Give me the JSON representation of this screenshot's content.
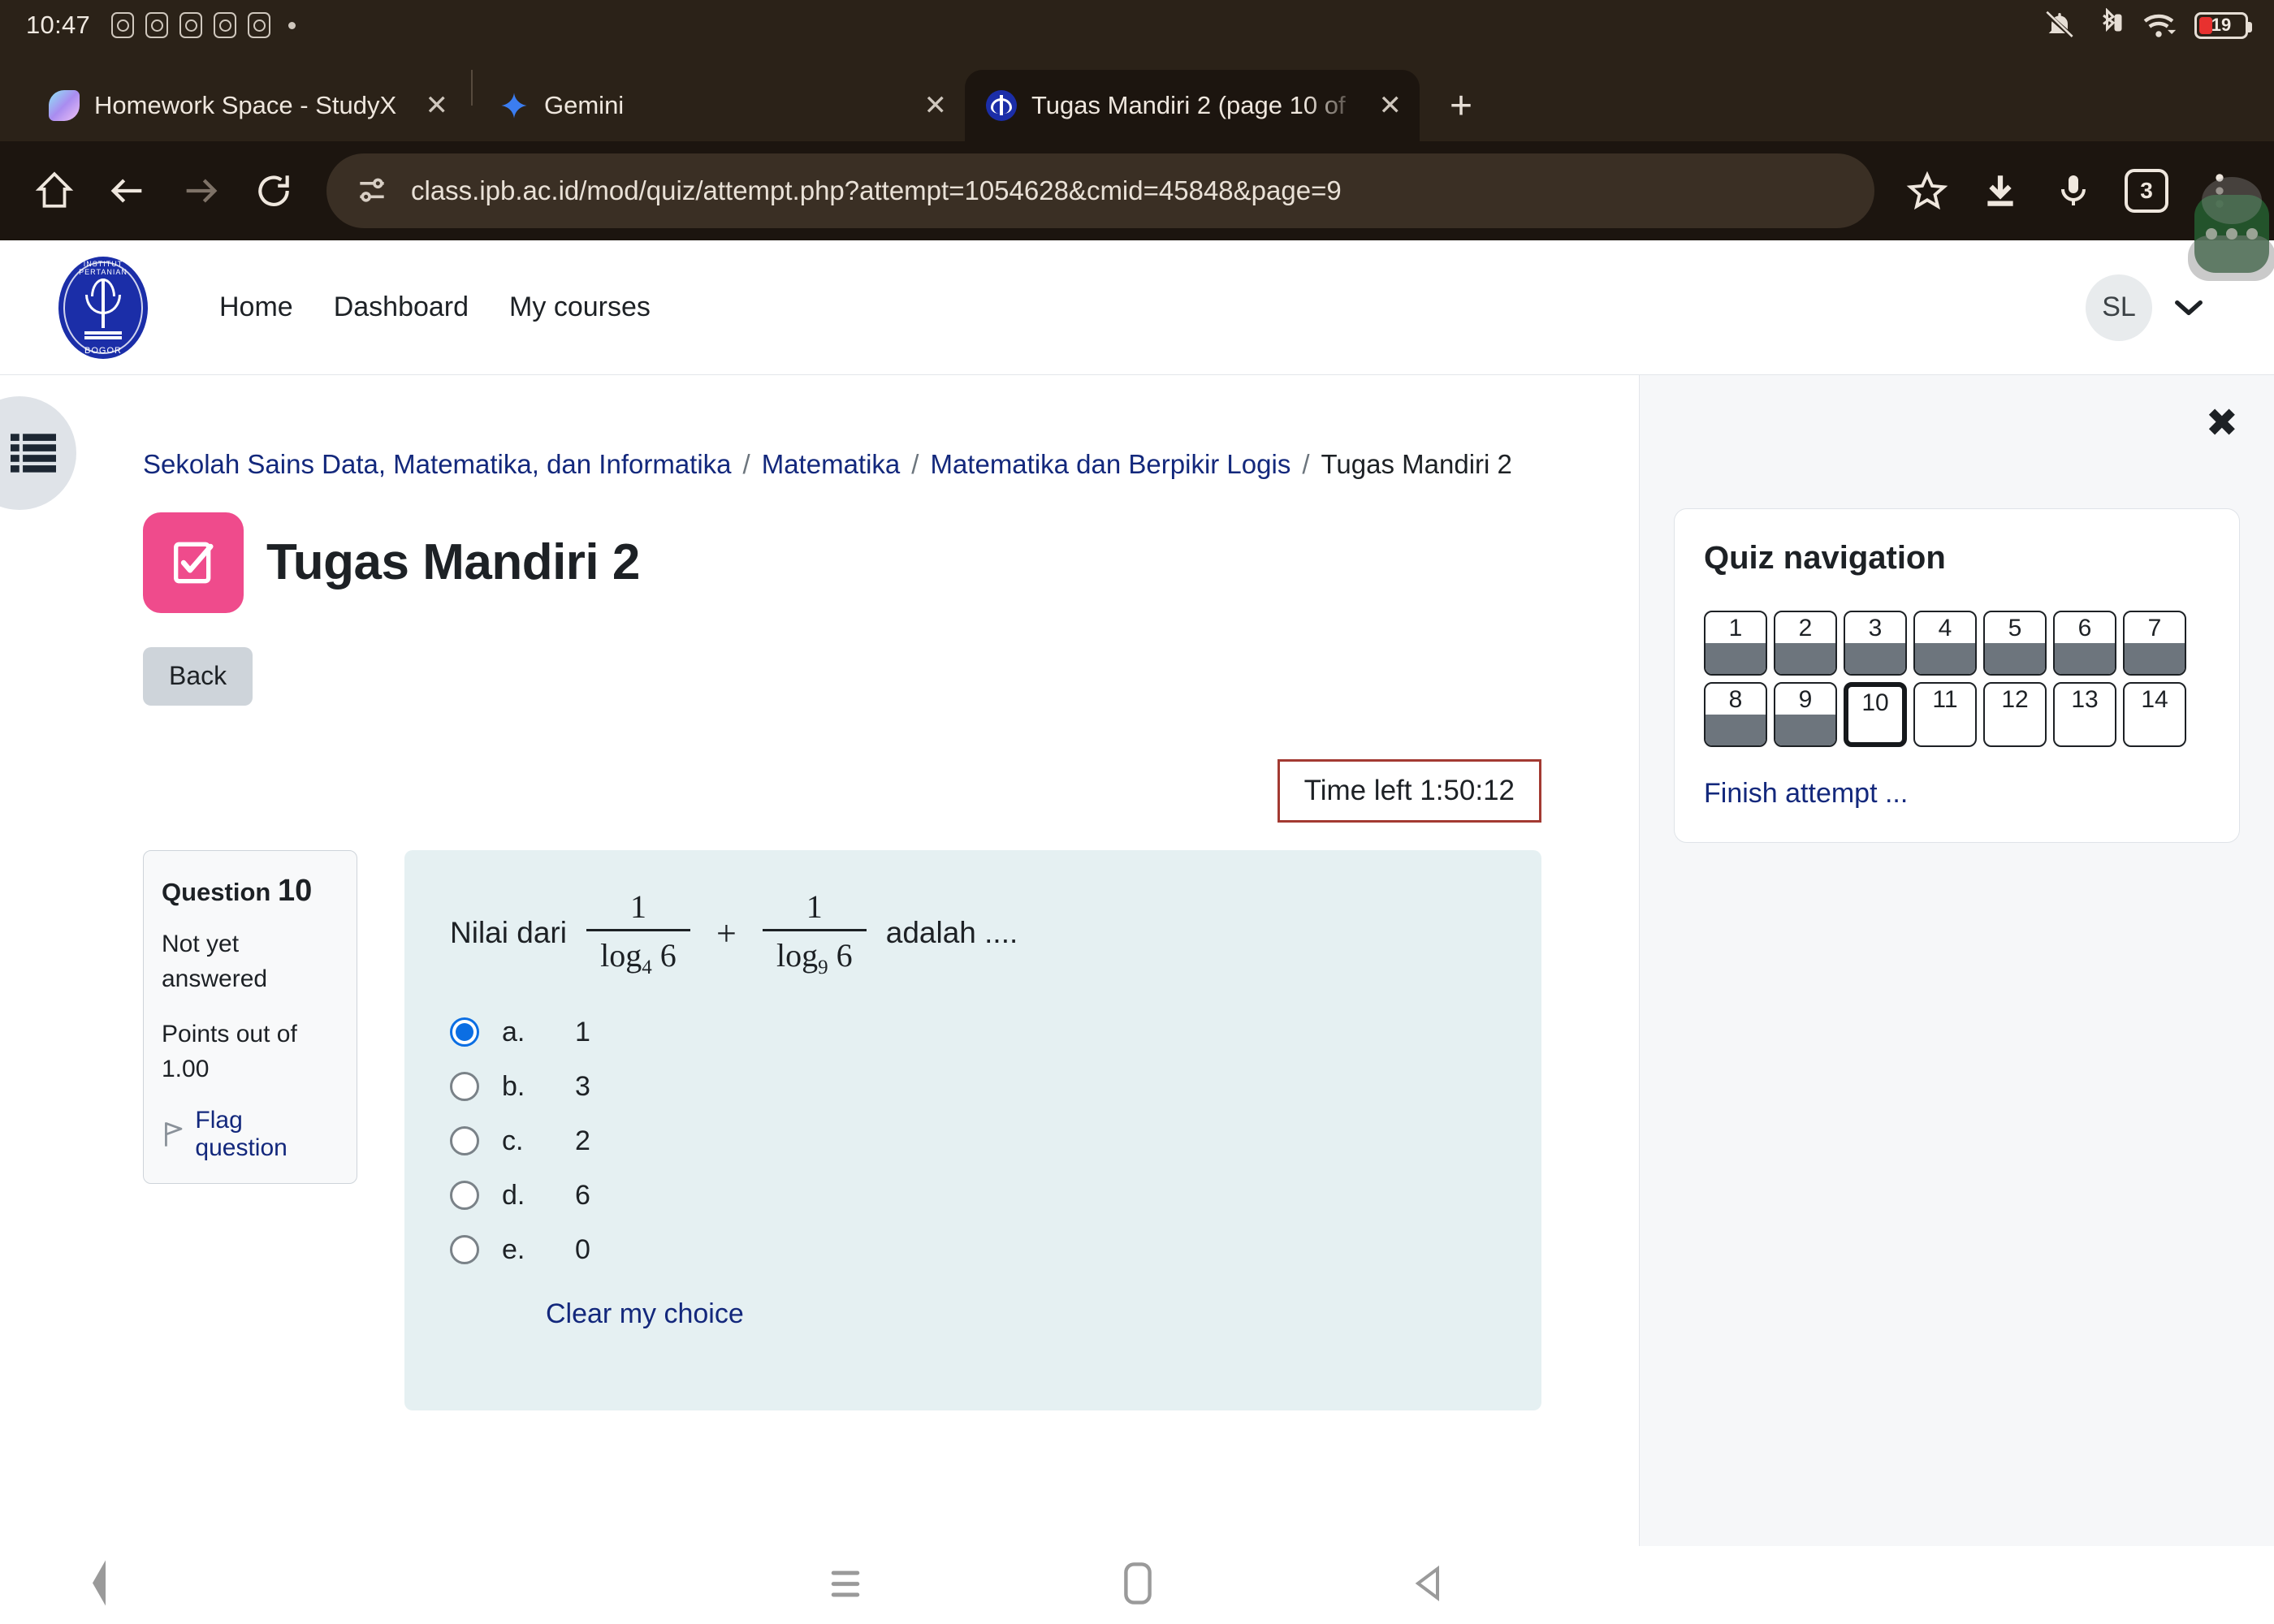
{
  "statusbar": {
    "clock": "10:47",
    "app_icons": [
      "camera-icon",
      "camera-icon",
      "camera-icon",
      "camera-icon",
      "camera-icon"
    ],
    "dot": "more-notifications-dot",
    "icons": [
      "bell-muted-icon",
      "bluetooth-icon",
      "wifi-icon"
    ],
    "battery_percent": "19"
  },
  "browser": {
    "tabs": [
      {
        "title": "Homework Space - StudyX",
        "favicon": "studyx-icon",
        "active": false,
        "close_label": "✕"
      },
      {
        "title": "Gemini",
        "favicon": "gemini-icon",
        "active": false,
        "close_label": "✕"
      },
      {
        "title": "Tugas Mandiri 2 (page 10 of",
        "favicon": "ipb-icon",
        "active": true,
        "close_label": "✕"
      }
    ],
    "new_tab_label": "+",
    "toolbar": {
      "home_icon": "home-icon",
      "back_icon": "back-arrow-icon",
      "forward_icon": "forward-arrow-icon",
      "reload_icon": "reload-icon",
      "site_info_icon": "site-settings-icon",
      "url": "class.ipb.ac.id/mod/quiz/attempt.php?attempt=1054628&cmid=45848&page=9",
      "bookmark_icon": "star-icon",
      "download_icon": "download-icon",
      "voice_icon": "microphone-icon",
      "tab_count": "3",
      "menu_icon": "overflow-menu-icon"
    },
    "floating_bubble": "assistant-bubble"
  },
  "site_header": {
    "logo": "ipb-bogor-logo",
    "nav": [
      {
        "label": "Home"
      },
      {
        "label": "Dashboard"
      },
      {
        "label": "My courses"
      }
    ],
    "avatar_initials": "SL",
    "avatar_chevron": "chevron-down-icon"
  },
  "page": {
    "drawer_toggle_icon": "course-index-icon",
    "breadcrumb": [
      {
        "label": "Sekolah Sains Data, Matematika, dan Informatika",
        "link": true
      },
      {
        "label": "Matematika",
        "link": true
      },
      {
        "label": "Matematika dan Berpikir Logis",
        "link": true
      },
      {
        "label": "Tugas Mandiri 2",
        "link": false
      }
    ],
    "breadcrumb_separator": "/",
    "title": "Tugas Mandiri 2",
    "title_icon": "quiz-checkbox-icon",
    "back_button": "Back",
    "timer_label": "Time left 1:50:12"
  },
  "question": {
    "info": {
      "label": "Question",
      "number": "10",
      "state": "Not yet answered",
      "points": "Points out of 1.00",
      "flag_label": "Flag question",
      "flag_icon": "flag-icon"
    },
    "stem_prefix": "Nilai dari",
    "fraction_1": {
      "numerator": "1",
      "denominator": "log",
      "denominator_sub": "4",
      "denominator_arg": "6"
    },
    "operator": "+",
    "fraction_2": {
      "numerator": "1",
      "denominator": "log",
      "denominator_sub": "9",
      "denominator_arg": "6"
    },
    "stem_suffix": "adalah ....",
    "options": [
      {
        "letter": "a.",
        "text": "1",
        "selected": true
      },
      {
        "letter": "b.",
        "text": "3",
        "selected": false
      },
      {
        "letter": "c.",
        "text": "2",
        "selected": false
      },
      {
        "letter": "d.",
        "text": "6",
        "selected": false
      },
      {
        "letter": "e.",
        "text": "0",
        "selected": false
      }
    ],
    "clear_choice": "Clear my choice"
  },
  "quiz_navigation": {
    "close_icon": "close-icon",
    "title": "Quiz navigation",
    "buttons": [
      {
        "label": "1",
        "state": "answered"
      },
      {
        "label": "2",
        "state": "answered"
      },
      {
        "label": "3",
        "state": "answered"
      },
      {
        "label": "4",
        "state": "answered"
      },
      {
        "label": "5",
        "state": "answered"
      },
      {
        "label": "6",
        "state": "answered"
      },
      {
        "label": "7",
        "state": "answered"
      },
      {
        "label": "8",
        "state": "answered"
      },
      {
        "label": "9",
        "state": "answered"
      },
      {
        "label": "10",
        "state": "current"
      },
      {
        "label": "11",
        "state": "unanswered"
      },
      {
        "label": "12",
        "state": "unanswered"
      },
      {
        "label": "13",
        "state": "unanswered"
      },
      {
        "label": "14",
        "state": "unanswered"
      }
    ],
    "finish_link": "Finish attempt ..."
  },
  "android_nav": {
    "edge_back_icon": "edge-back-icon",
    "recents_icon": "recents-icon",
    "home_icon": "home-pill-icon",
    "back_icon": "back-triangle-icon"
  },
  "colors": {
    "browser_chrome": "#2b2218",
    "browser_toolbar": "#1c150f",
    "accent_pink": "#ef4b8c",
    "link_blue": "#13287c",
    "question_bg": "#e5f0f2",
    "timer_border": "#a33a32",
    "radio_selected": "#0b6ee3",
    "answered_gray": "#6d757d",
    "battery_red": "#e8312f"
  }
}
